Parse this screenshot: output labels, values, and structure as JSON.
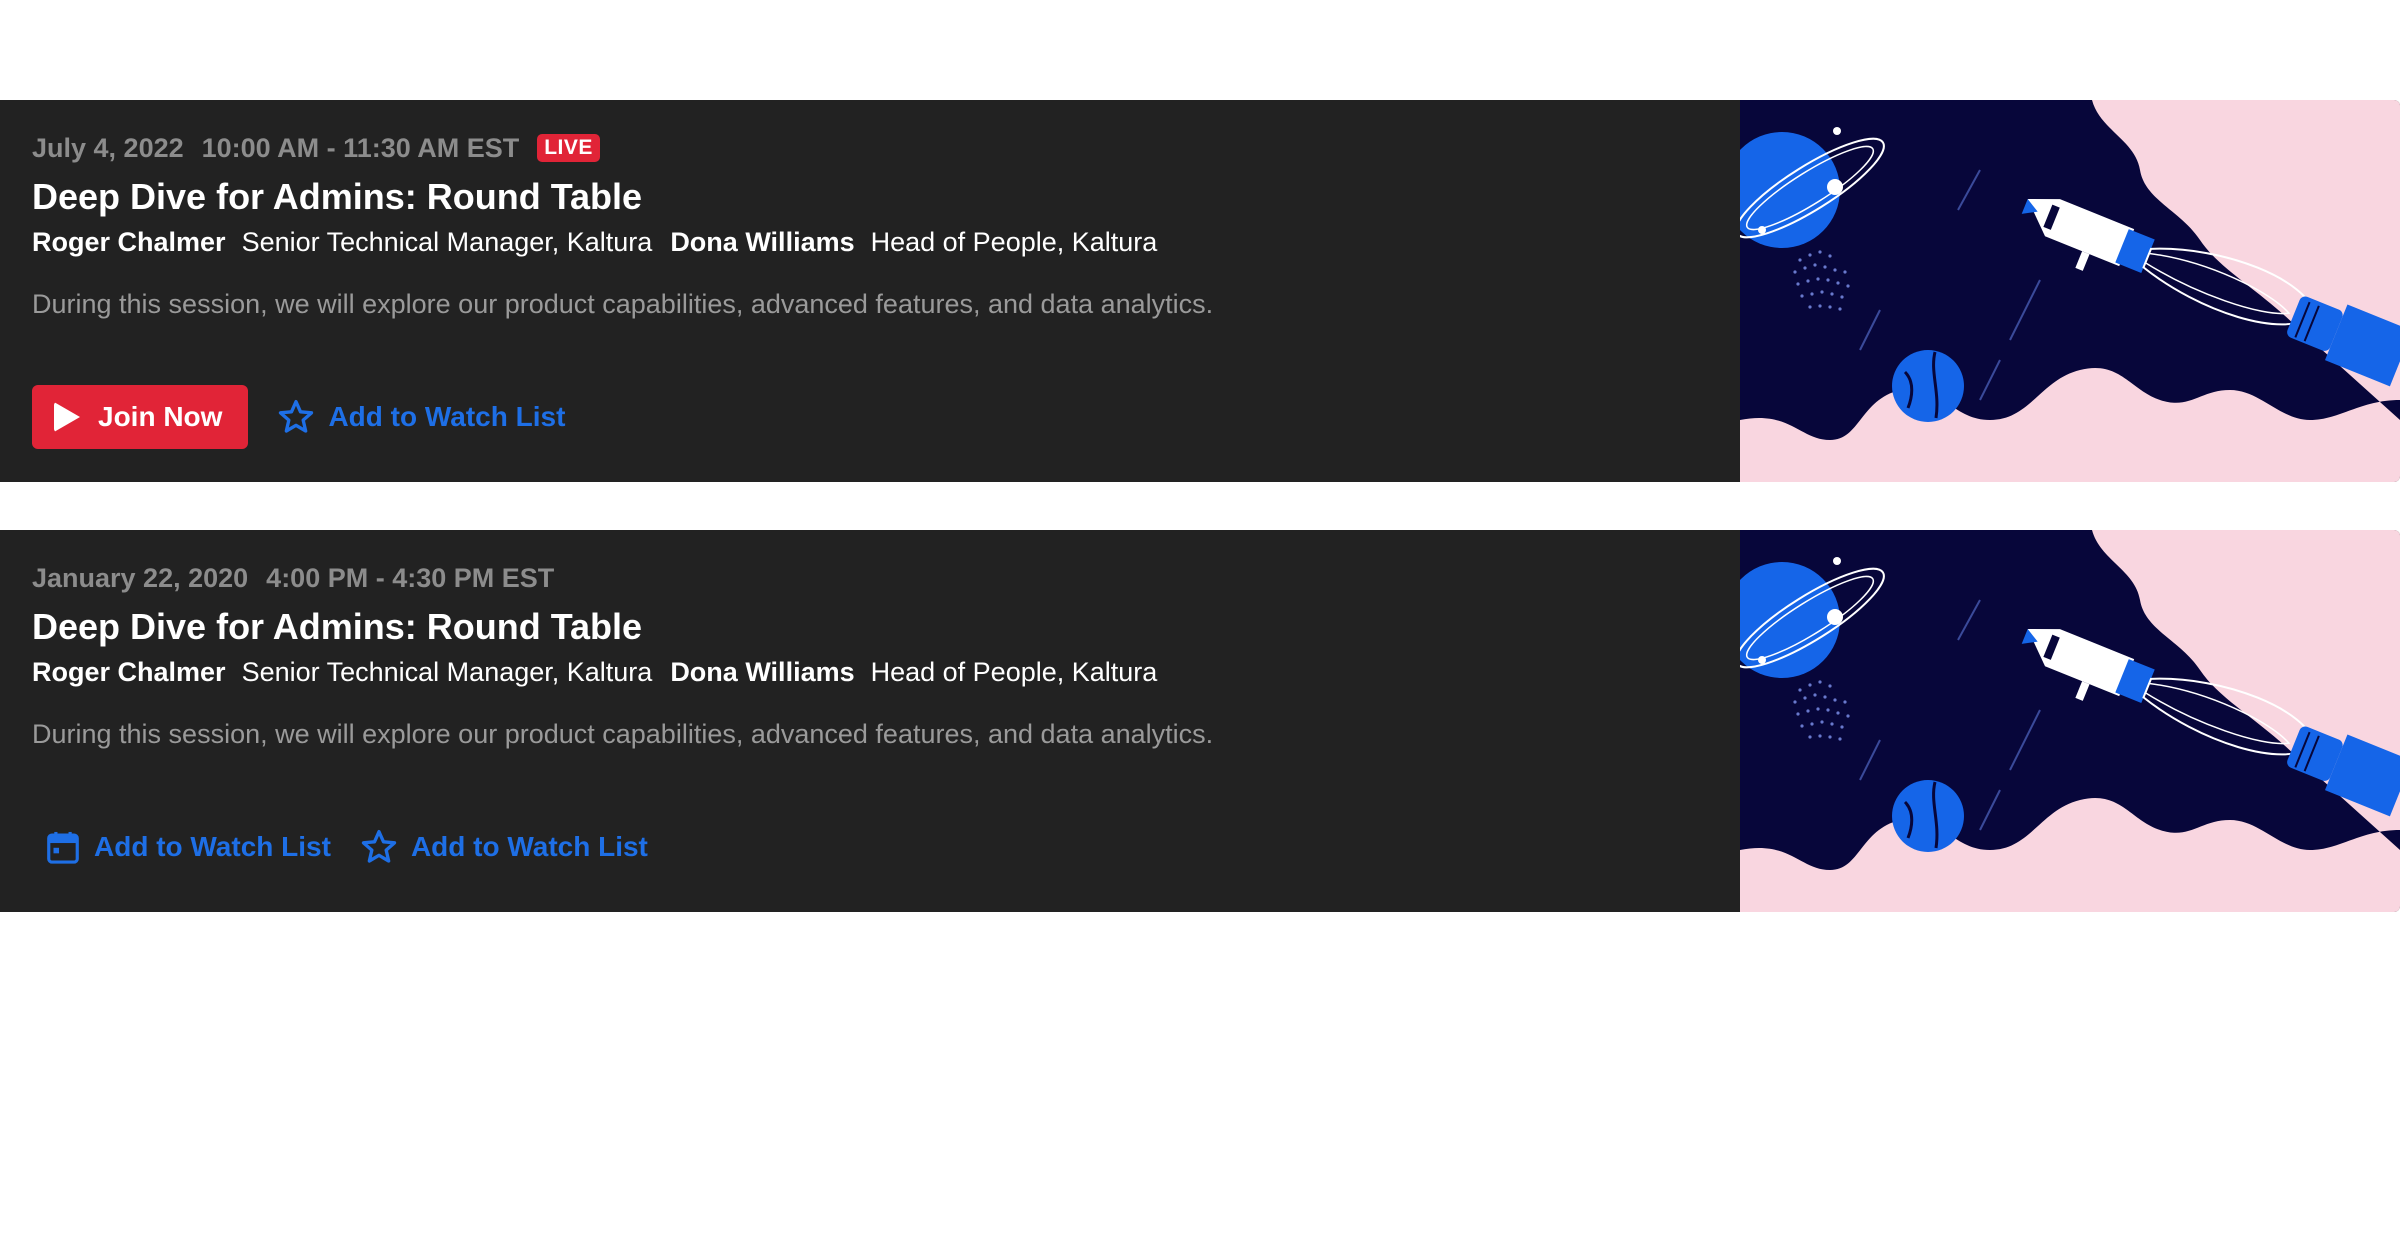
{
  "sessions": [
    {
      "date": "July 4, 2022",
      "time": "10:00 AM - 11:30 AM EST",
      "live_badge": "LIVE",
      "title": "Deep Dive for Admins: Round Table",
      "presenters": [
        {
          "name": "Roger Chalmer",
          "role": "Senior Technical Manager, Kaltura"
        },
        {
          "name": "Dona Williams",
          "role": "Head of People, Kaltura"
        }
      ],
      "description": "During this session, we will explore our product capabilities, advanced features, and data analytics.",
      "primary_action": {
        "label": "Join Now",
        "icon": "play-icon"
      },
      "secondary_action": {
        "label": "Add to Watch List",
        "icon": "star-icon"
      }
    },
    {
      "date": "January 22, 2020",
      "time": "4:00 PM - 4:30 PM EST",
      "title": "Deep Dive for Admins: Round Table",
      "presenters": [
        {
          "name": "Roger Chalmer",
          "role": "Senior Technical Manager, Kaltura"
        },
        {
          "name": "Dona Williams",
          "role": "Head of People, Kaltura"
        }
      ],
      "description": "During this session, we will explore our product capabilities, advanced features, and data analytics.",
      "primary_action": {
        "label": "Add to Watch List",
        "icon": "calendar-icon"
      },
      "secondary_action": {
        "label": "Add to Watch List",
        "icon": "star-icon"
      }
    }
  ],
  "colors": {
    "card_bg": "#222222",
    "accent_red": "#e12437",
    "link_blue": "#1e6fe6",
    "thumb_navy": "#07063a",
    "thumb_pink": "#f9d6e0",
    "thumb_blue": "#1565e8"
  }
}
